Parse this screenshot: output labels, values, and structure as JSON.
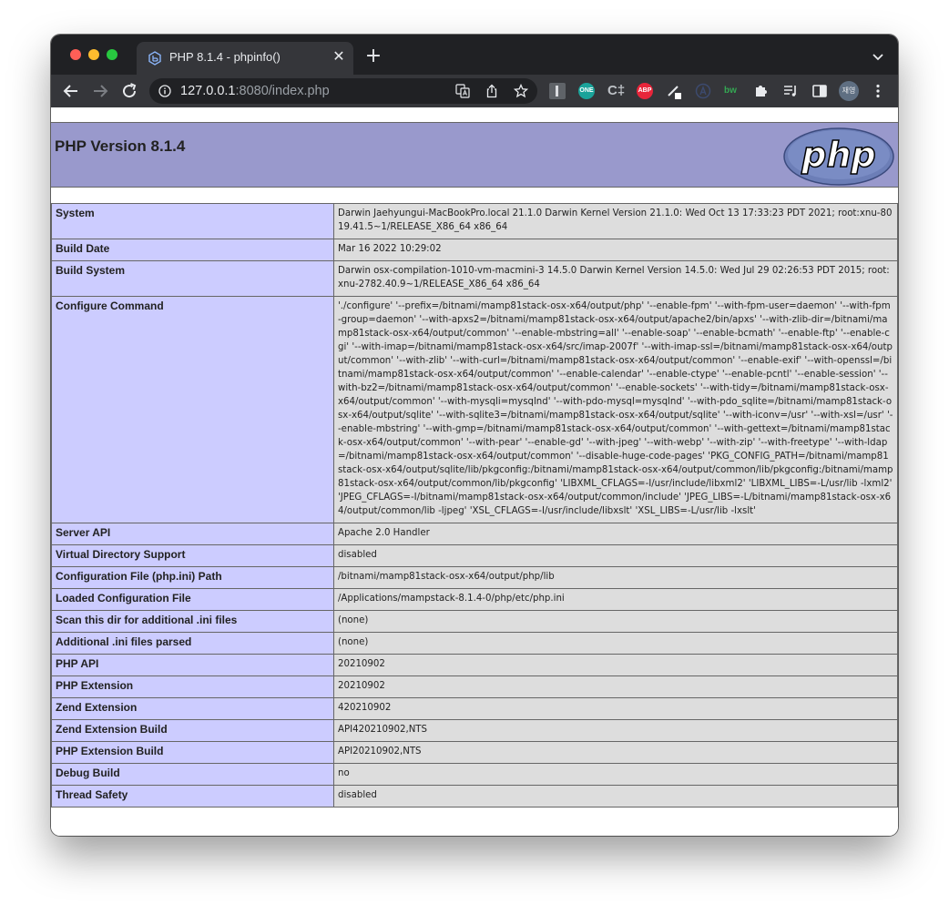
{
  "browser": {
    "tab_title": "PHP 8.1.4 - phpinfo()",
    "url_host": "127.0.0.1",
    "url_rest": ":8080/index.php",
    "profile_label": "재영",
    "extensions": [
      "ONE",
      "C‡",
      "ABP",
      "bw"
    ]
  },
  "colors": {
    "header_bg": "#9999cc",
    "label_bg": "#ccccff",
    "value_bg": "#dddddd"
  },
  "page": {
    "title": "PHP Version 8.1.4",
    "logo_text": "php"
  },
  "rows": [
    {
      "label": "System",
      "value": "Darwin Jaehyungui-MacBookPro.local 21.1.0 Darwin Kernel Version 21.1.0: Wed Oct 13 17:33:23 PDT 2021; root:xnu-8019.41.5~1/RELEASE_X86_64 x86_64"
    },
    {
      "label": "Build Date",
      "value": "Mar 16 2022 10:29:02"
    },
    {
      "label": "Build System",
      "value": "Darwin osx-compilation-1010-vm-macmini-3 14.5.0 Darwin Kernel Version 14.5.0: Wed Jul 29 02:26:53 PDT 2015; root:xnu-2782.40.9~1/RELEASE_X86_64 x86_64"
    },
    {
      "label": "Configure Command",
      "value": "'./configure' '--prefix=/bitnami/mamp81stack-osx-x64/output/php' '--enable-fpm' '--with-fpm-user=daemon' '--with-fpm-group=daemon' '--with-apxs2=/bitnami/mamp81stack-osx-x64/output/apache2/bin/apxs' '--with-zlib-dir=/bitnami/mamp81stack-osx-x64/output/common' '--enable-mbstring=all' '--enable-soap' '--enable-bcmath' '--enable-ftp' '--enable-cgi' '--with-imap=/bitnami/mamp81stack-osx-x64/src/imap-2007f' '--with-imap-ssl=/bitnami/mamp81stack-osx-x64/output/common' '--with-zlib' '--with-curl=/bitnami/mamp81stack-osx-x64/output/common' '--enable-exif' '--with-openssl=/bitnami/mamp81stack-osx-x64/output/common' '--enable-calendar' '--enable-ctype' '--enable-pcntl' '--enable-session' '--with-bz2=/bitnami/mamp81stack-osx-x64/output/common' '--enable-sockets' '--with-tidy=/bitnami/mamp81stack-osx-x64/output/common' '--with-mysqli=mysqlnd' '--with-pdo-mysql=mysqlnd' '--with-pdo_sqlite=/bitnami/mamp81stack-osx-x64/output/sqlite' '--with-sqlite3=/bitnami/mamp81stack-osx-x64/output/sqlite' '--with-iconv=/usr' '--with-xsl=/usr' '--enable-mbstring' '--with-gmp=/bitnami/mamp81stack-osx-x64/output/common' '--with-gettext=/bitnami/mamp81stack-osx-x64/output/common' '--with-pear' '--enable-gd' '--with-jpeg' '--with-webp' '--with-zip' '--with-freetype' '--with-ldap=/bitnami/mamp81stack-osx-x64/output/common' '--disable-huge-code-pages' 'PKG_CONFIG_PATH=/bitnami/mamp81stack-osx-x64/output/sqlite/lib/pkgconfig:/bitnami/mamp81stack-osx-x64/output/common/lib/pkgconfig:/bitnami/mamp81stack-osx-x64/output/common/lib/pkgconfig' 'LIBXML_CFLAGS=-I/usr/include/libxml2' 'LIBXML_LIBS=-L/usr/lib -lxml2' 'JPEG_CFLAGS=-I/bitnami/mamp81stack-osx-x64/output/common/include' 'JPEG_LIBS=-L/bitnami/mamp81stack-osx-x64/output/common/lib -ljpeg' 'XSL_CFLAGS=-I/usr/include/libxslt' 'XSL_LIBS=-L/usr/lib -lxslt'"
    },
    {
      "label": "Server API",
      "value": "Apache 2.0 Handler"
    },
    {
      "label": "Virtual Directory Support",
      "value": "disabled"
    },
    {
      "label": "Configuration File (php.ini) Path",
      "value": "/bitnami/mamp81stack-osx-x64/output/php/lib"
    },
    {
      "label": "Loaded Configuration File",
      "value": "/Applications/mampstack-8.1.4-0/php/etc/php.ini"
    },
    {
      "label": "Scan this dir for additional .ini files",
      "value": "(none)"
    },
    {
      "label": "Additional .ini files parsed",
      "value": "(none)"
    },
    {
      "label": "PHP API",
      "value": "20210902"
    },
    {
      "label": "PHP Extension",
      "value": "20210902"
    },
    {
      "label": "Zend Extension",
      "value": "420210902"
    },
    {
      "label": "Zend Extension Build",
      "value": "API420210902,NTS"
    },
    {
      "label": "PHP Extension Build",
      "value": "API20210902,NTS"
    },
    {
      "label": "Debug Build",
      "value": "no"
    },
    {
      "label": "Thread Safety",
      "value": "disabled"
    }
  ]
}
